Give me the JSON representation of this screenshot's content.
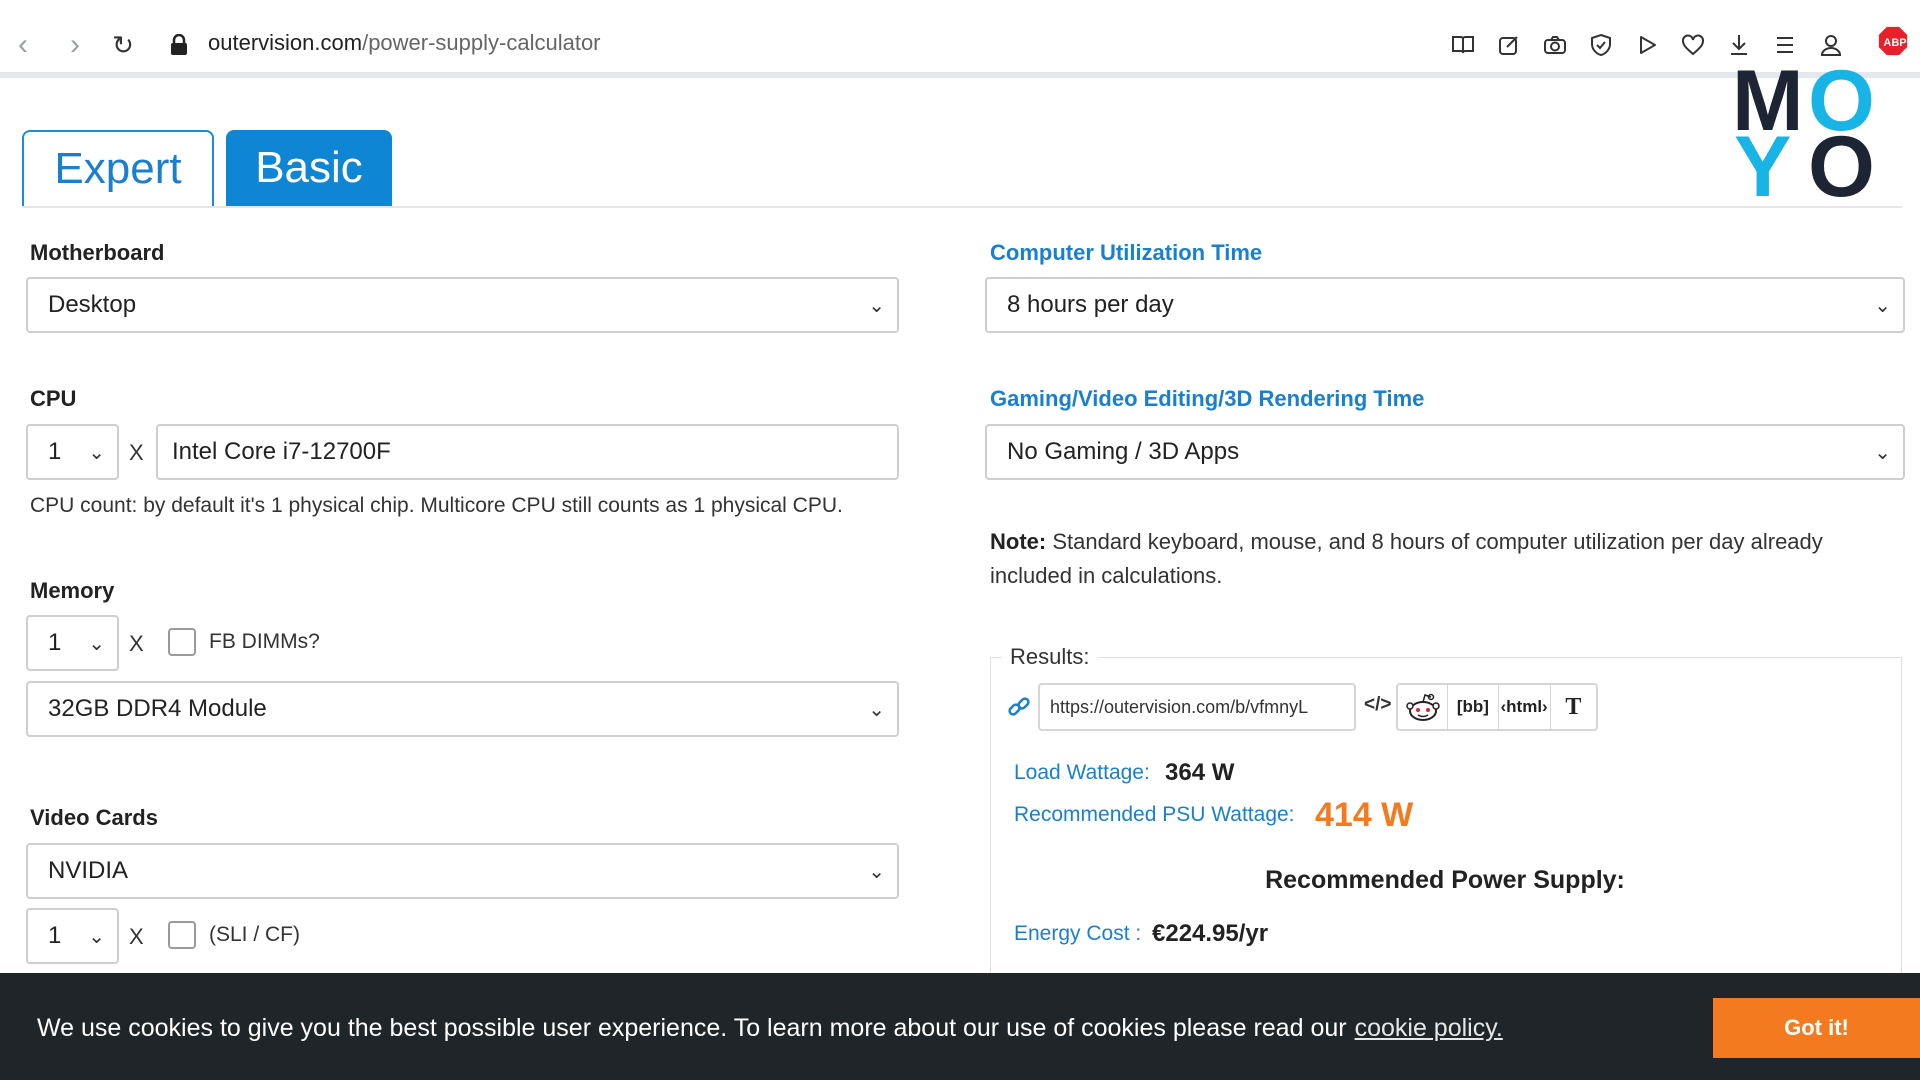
{
  "browser": {
    "url_domain": "outervision.com",
    "url_path": "/power-supply-calculator",
    "icons": [
      "back-icon",
      "forward-icon",
      "reload-icon",
      "lock-icon",
      "reader-icon",
      "edit-icon",
      "camera-icon",
      "shield-icon",
      "play-icon",
      "heart-icon",
      "download-icon",
      "menu-icon",
      "profile-icon",
      "adblock-icon"
    ],
    "adblock_label": "ABP"
  },
  "logo": {
    "letters": [
      "M",
      "O",
      "Y",
      "O"
    ],
    "colors": {
      "dark": "#1d2433",
      "blue": "#18b4e6"
    }
  },
  "tabs": {
    "expert": "Expert",
    "basic": "Basic"
  },
  "left": {
    "motherboard": {
      "label": "Motherboard",
      "value": "Desktop"
    },
    "cpu": {
      "label": "CPU",
      "count": "1",
      "x": "X",
      "model": "Intel Core i7-12700F",
      "help": "CPU count: by default it's 1 physical chip. Multicore CPU still counts as 1 physical CPU."
    },
    "memory": {
      "label": "Memory",
      "count": "1",
      "x": "X",
      "fb_label": "FB DIMMs?",
      "module": "32GB DDR4 Module"
    },
    "video": {
      "label": "Video Cards",
      "brand": "NVIDIA",
      "count": "1",
      "x": "X",
      "sli_label": "(SLI / CF)"
    }
  },
  "right": {
    "utilization": {
      "label": "Computer Utilization Time",
      "value": "8 hours per day"
    },
    "gaming": {
      "label": "Gaming/Video Editing/3D Rendering Time",
      "value": "No Gaming / 3D Apps"
    },
    "note_bold": "Note:",
    "note_text": " Standard keyboard, mouse, and 8 hours of computer utilization per day already included in calculations."
  },
  "results": {
    "legend": "Results:",
    "share_url": "https://outervision.com/b/vfmnyL",
    "share_buttons": {
      "embed": "</>",
      "bb": "[bb]",
      "html": "‹html›",
      "text": "T"
    },
    "load_label": "Load Wattage:",
    "load_value": "364 W",
    "psu_label": "Recommended PSU Wattage:",
    "psu_value": "414 W",
    "rec_title": "Recommended Power Supply:",
    "energy_label": "Energy Cost :",
    "energy_value": "€224.95/yr"
  },
  "cookie": {
    "text": "We use cookies to give you the best possible user experience. To learn more about our use of cookies please read our",
    "link": "cookie policy.",
    "button": "Got it!"
  }
}
